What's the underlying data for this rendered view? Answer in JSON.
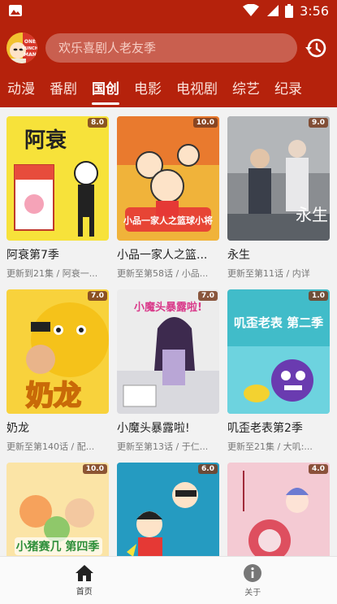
{
  "status_bar": {
    "time": "3:56"
  },
  "header": {
    "search_placeholder": "欢乐喜剧人老友季",
    "avatar_text": "ONE PUNCH MAN"
  },
  "tabs": [
    {
      "label": "动漫",
      "active": false
    },
    {
      "label": "番剧",
      "active": false
    },
    {
      "label": "国创",
      "active": true
    },
    {
      "label": "电影",
      "active": false
    },
    {
      "label": "电视剧",
      "active": false
    },
    {
      "label": "综艺",
      "active": false
    },
    {
      "label": "纪录",
      "active": false
    }
  ],
  "items": [
    {
      "title": "阿衰第7季",
      "subtitle": "更新到21集 / 阿衰一...",
      "score": "8.0",
      "cover_text": "阿衰"
    },
    {
      "title": "小品一家人之篮...",
      "subtitle": "更新至第58话 / 小品...",
      "score": "10.0",
      "cover_text": "小品一家人之篮球小将"
    },
    {
      "title": "永生",
      "subtitle": "更新至第11话 / 内详",
      "score": "9.0",
      "cover_text": "永生"
    },
    {
      "title": "奶龙",
      "subtitle": "更新至第140话 / 配...",
      "score": "7.0",
      "cover_text": "奶龙"
    },
    {
      "title": "小魔头暴露啦!",
      "subtitle": "更新至第13话 / 于仁...",
      "score": "7.0",
      "cover_text": "小魔头暴露啦!"
    },
    {
      "title": "叽歪老表第2季",
      "subtitle": "更新至21集 / 大叽:...",
      "score": "1.0",
      "cover_text": "叽歪老表 第二季"
    },
    {
      "title": "",
      "subtitle": "",
      "score": "10.0",
      "cover_text": "小猪赛几 第四季"
    },
    {
      "title": "",
      "subtitle": "",
      "score": "6.0",
      "cover_text": ""
    },
    {
      "title": "",
      "subtitle": "",
      "score": "4.0",
      "cover_text": ""
    }
  ],
  "bottom_nav": [
    {
      "label": "首页",
      "icon": "home-icon",
      "active": true
    },
    {
      "label": "关于",
      "icon": "info-icon",
      "active": false
    }
  ],
  "colors": {
    "primary": "#b5220c",
    "badge": "#7a3c1e"
  }
}
